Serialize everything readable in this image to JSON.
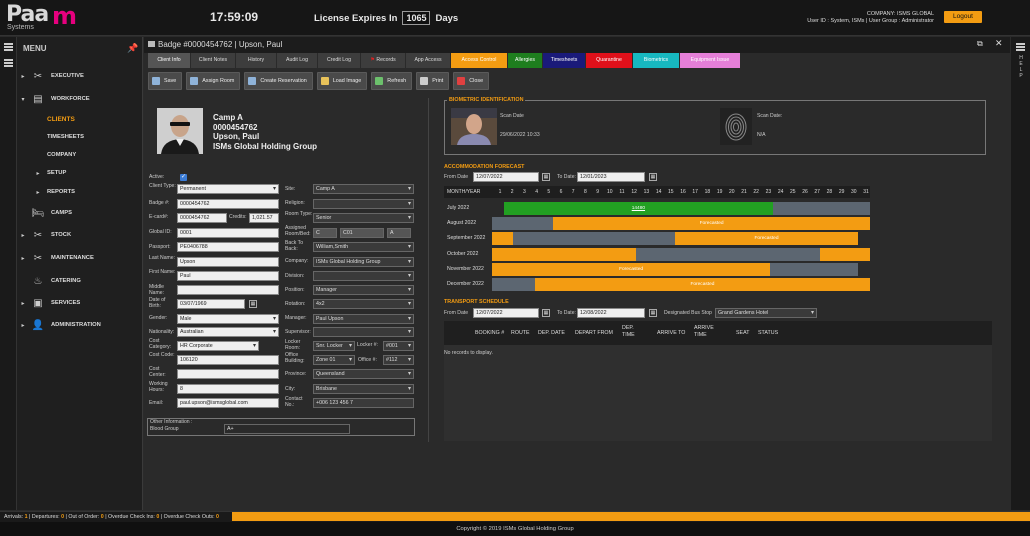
{
  "header": {
    "logo_text": "Paa",
    "logo_mark": "m",
    "logo_sub": "Systems",
    "time": "17:59:09",
    "license_label": "License Expires In",
    "license_days": "1065",
    "license_unit": "Days",
    "company_line": "COMPANY: ISMS GLOBAL",
    "user_line": "User ID : System, ISMs | User Group : Administrator",
    "logout_label": "Logout"
  },
  "sidebar": {
    "title": "MENU",
    "items": [
      {
        "label": "EXECUTIVE",
        "icon": "tools-icon"
      },
      {
        "label": "WORKFORCE",
        "icon": "id-card-icon"
      },
      {
        "label": "CLIENTS",
        "icon": ""
      },
      {
        "label": "TIMESHEETS",
        "icon": ""
      },
      {
        "label": "COMPANY",
        "icon": ""
      },
      {
        "label": "SETUP",
        "icon": ""
      },
      {
        "label": "REPORTS",
        "icon": ""
      },
      {
        "label": "CAMPS",
        "icon": "bed-icon"
      },
      {
        "label": "STOCK",
        "icon": "tools-icon"
      },
      {
        "label": "MAINTENANCE",
        "icon": "tools-icon"
      },
      {
        "label": "CATERING",
        "icon": "catering-icon"
      },
      {
        "label": "SERVICES",
        "icon": "box-icon"
      },
      {
        "label": "ADMINISTRATION",
        "icon": "user-icon"
      }
    ]
  },
  "window": {
    "title": "Badge #0000454762 | Upson, Paul"
  },
  "tabs": [
    {
      "label": "Client Info",
      "color": "#555555"
    },
    {
      "label": "Client Notes",
      "color": "#3d3d3d"
    },
    {
      "label": "History",
      "color": "#3d3d3d"
    },
    {
      "label": "Audit Log",
      "color": "#3d3d3d"
    },
    {
      "label": "Credit Log",
      "color": "#3d3d3d"
    },
    {
      "label": "Records",
      "color": "#3d3d3d"
    },
    {
      "label": "App Access",
      "color": "#3d3d3d"
    },
    {
      "label": "Access Control",
      "color": "#f39c12"
    },
    {
      "label": "Allergies",
      "color": "#1e7e1e"
    },
    {
      "label": "Timesheets",
      "color": "#1a1a7a"
    },
    {
      "label": "Quarantine",
      "color": "#e0101a"
    },
    {
      "label": "Biometrics",
      "color": "#17b8c0"
    },
    {
      "label": "Equipment Issue",
      "color": "#e57fd8"
    }
  ],
  "toolbar": {
    "save": "Save",
    "assign_room": "Assign Room",
    "create_reservation": "Create Reservation",
    "load_image": "Load Image",
    "refresh": "Refresh",
    "print": "Print",
    "close": "Close"
  },
  "profile": {
    "camp": "Camp A",
    "badge": "0000454762",
    "name": "Upson, Paul",
    "company": "ISMs Global Holding Group"
  },
  "form": {
    "active_label": "Active:",
    "client_type_label": "Client Type:",
    "client_type": "Permanent",
    "badge_label": "Badge #:",
    "badge": "0000454762",
    "ecard_label": "E-card#:",
    "ecard": "0000454762",
    "credits_label": "Credits:",
    "credits": "1,021.57",
    "global_id_label": "Global ID:",
    "global_id": "0001",
    "passport_label": "Passport:",
    "passport": "PE0406788",
    "last_name_label": "Last Name:",
    "last_name": "Upson",
    "first_name_label": "First Name:",
    "first_name": "Paul",
    "middle_name_label": "Middle Name:",
    "middle_name": "",
    "dob_label": "Date of Birth:",
    "dob": "03/07/1969",
    "gender_label": "Gender:",
    "gender": "Male",
    "nationality_label": "Nationality:",
    "nationality": "Australian",
    "cost_category_label": "Cost Category:",
    "cost_category": "HR Corporate",
    "cost_code_label": "Cost Code:",
    "cost_code": "106120",
    "cost_center_label": "Cost Center:",
    "cost_center": "",
    "working_hours_label": "Working Hours:",
    "working_hours": "8",
    "email_label": "Email:",
    "email": "paul.upson@ismsglobal.com",
    "site_label": "Site:",
    "site": "Camp A",
    "religion_label": "Religion:",
    "religion": "",
    "room_type_label": "Room Type:",
    "room_type": "Senior",
    "assigned_room_label": "Assigned Room/Bed:",
    "room_block": "C",
    "room_no": "C01",
    "room_bed": "A",
    "back_to_back_label": "Back To Back:",
    "back_to_back": "William,Smith",
    "company_label": "Company:",
    "company": "ISMs Global Holding Group",
    "division_label": "Division:",
    "division": "",
    "position_label": "Position:",
    "position": "Manager",
    "rotation_label": "Rotation:",
    "rotation": "4x2",
    "manager_label": "Manager:",
    "manager": "Paul Upson",
    "supervisor_label": "Supervisor:",
    "supervisor": "",
    "locker_room_label": "Locker Room:",
    "locker_room": "Snr. Locker",
    "locker_no_label": "Locker #:",
    "locker_no": "#001",
    "office_building_label": "Office Building:",
    "office_building": "Zone 01",
    "office_no_label": "Office #:",
    "office_no": "#112",
    "province_label": "Province:",
    "province": "Queensland",
    "city_label": "City:",
    "city": "Brisbane",
    "contact_label": "Contact No.:",
    "contact": "+006 123 456 7",
    "other_info_label": "Other Information :",
    "blood_group_label": "Blood Group",
    "blood_group": "A+"
  },
  "biometric": {
    "title": "BIOMETRIC IDENTIFICATION",
    "face_scan_label": "Scan Date",
    "face_scan_date": "29/06/2022 10:33",
    "finger_scan_label": "Scan Date:",
    "finger_scan_date": "N/A"
  },
  "accommodation": {
    "title": "ACCOMMODATION FORECAST",
    "from_label": "From Date",
    "from": "12/07/2022",
    "to_label": "To Date:",
    "to": "12/01/2023",
    "month_header": "MONTH/YEAR",
    "days": [
      "1",
      "2",
      "3",
      "4",
      "5",
      "6",
      "7",
      "8",
      "9",
      "10",
      "11",
      "12",
      "13",
      "14",
      "15",
      "16",
      "17",
      "18",
      "19",
      "20",
      "21",
      "22",
      "23",
      "24",
      "25",
      "26",
      "27",
      "28",
      "29",
      "30",
      "31"
    ],
    "rows": [
      {
        "month": "July 2022",
        "segments": [
          {
            "start": 1,
            "end": 23,
            "color": "#22a022",
            "label": "14480"
          },
          {
            "start": 23,
            "end": 31,
            "color": "#5c6671",
            "label": ""
          }
        ]
      },
      {
        "month": "August 2022",
        "segments": [
          {
            "start": 0,
            "end": 5,
            "color": "#5c6671",
            "label": ""
          },
          {
            "start": 5,
            "end": 31,
            "color": "#f39c12",
            "label": "Forecasted"
          }
        ]
      },
      {
        "month": "September 2022",
        "segments": [
          {
            "start": 0,
            "end": 1.7,
            "color": "#f39c12",
            "label": ""
          },
          {
            "start": 1.7,
            "end": 15,
            "color": "#5c6671",
            "label": ""
          },
          {
            "start": 15,
            "end": 30,
            "color": "#f39c12",
            "label": "Forecasted"
          }
        ]
      },
      {
        "month": "October 2022",
        "segments": [
          {
            "start": 0,
            "end": 11.8,
            "color": "#f39c12",
            "label": ""
          },
          {
            "start": 11.8,
            "end": 26.9,
            "color": "#5c6671",
            "label": ""
          },
          {
            "start": 26.9,
            "end": 31,
            "color": "#f39c12",
            "label": ""
          }
        ]
      },
      {
        "month": "November 2022",
        "segments": [
          {
            "start": 0,
            "end": 22.8,
            "color": "#f39c12",
            "label": "Forecasted"
          },
          {
            "start": 22.8,
            "end": 30,
            "color": "#5c6671",
            "label": ""
          }
        ]
      },
      {
        "month": "December 2022",
        "segments": [
          {
            "start": 0,
            "end": 3.5,
            "color": "#5c6671",
            "label": ""
          },
          {
            "start": 3.5,
            "end": 31,
            "color": "#f39c12",
            "label": "Forecasted"
          }
        ]
      }
    ]
  },
  "transport": {
    "title": "TRANSPORT SCHEDULE",
    "from_label": "From Date",
    "from": "12/07/2022",
    "to_label": "To Date:",
    "to": "12/08/2022",
    "bus_stop_label": "Designated Bus Stop",
    "bus_stop": "Grand Gardens Hotel",
    "columns": [
      "BOOKING #",
      "ROUTE",
      "DEP. DATE",
      "DEPART FROM",
      "DEP. TIME",
      "ARRIVE TO",
      "ARRIVE TIME",
      "SEAT",
      "STATUS"
    ],
    "empty_text": "No records to display."
  },
  "status": {
    "arrivals_label": "Arrivals:",
    "arrivals": "1",
    "departures_label": "Departures:",
    "departures": "0",
    "out_of_order_label": "Out of Order:",
    "out_of_order": "0",
    "overdue_in_label": "Overdue Check Ins:",
    "overdue_in": "0",
    "overdue_out_label": "Overdue Check Outs:",
    "overdue_out": "0"
  },
  "footer": {
    "copyright": "Copyright © 2019 ISMs Global Holding Group"
  }
}
